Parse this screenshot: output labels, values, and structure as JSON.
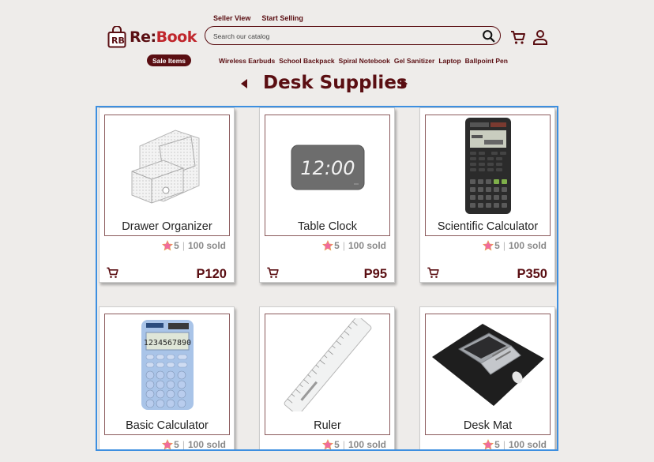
{
  "header": {
    "logo_text_a": "Re:",
    "logo_text_b": "Book",
    "top_links": [
      "Seller View",
      "Start Selling"
    ],
    "search_placeholder": "Search our catalog",
    "sale_label": "Sale Items",
    "categories": [
      "Wireless Earbuds",
      "School Backpack",
      "Spiral Notebook",
      "Gel Sanitizer",
      "Laptop",
      "Ballpoint Pen"
    ]
  },
  "page": {
    "title": "Desk Supplies"
  },
  "products": [
    {
      "name": "Drawer Organizer",
      "rating": "5",
      "sold": "100 sold",
      "price": "P120"
    },
    {
      "name": "Table Clock",
      "rating": "5",
      "sold": "100 sold",
      "price": "P95",
      "display": "12:00"
    },
    {
      "name": "Scientific Calculator",
      "rating": "5",
      "sold": "100 sold",
      "price": "P350"
    },
    {
      "name": "Basic Calculator",
      "rating": "5",
      "sold": "100 sold",
      "price": ""
    },
    {
      "name": "Ruler",
      "rating": "5",
      "sold": "100 sold",
      "price": ""
    },
    {
      "name": "Desk Mat",
      "rating": "5",
      "sold": "100 sold",
      "price": ""
    }
  ],
  "colors": {
    "brand": "#5a0e12",
    "accent_red": "#c0262c",
    "selection": "#3d8fe0",
    "star": "#f06ba0"
  }
}
